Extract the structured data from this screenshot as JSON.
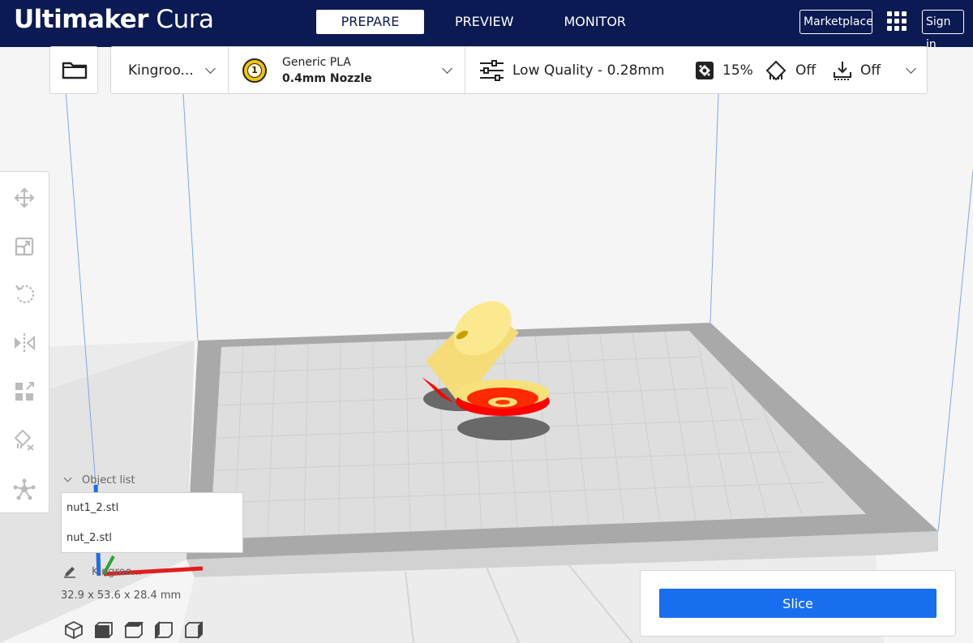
{
  "app": {
    "brand_bold": "Ultimaker",
    "brand_light": "Cura"
  },
  "stages": [
    {
      "label": "PREPARE",
      "active": true
    },
    {
      "label": "PREVIEW",
      "active": false
    },
    {
      "label": "MONITOR",
      "active": false
    }
  ],
  "header_buttons": {
    "marketplace": "Marketplace",
    "sign_in": "Sign in"
  },
  "toolbar": {
    "printer": "Kingroo...",
    "extruder_number": "1",
    "material": "Generic PLA",
    "nozzle": "0.4mm Nozzle",
    "quality": "Low Quality - 0.28mm",
    "infill": "15%",
    "support": "Off",
    "adhesion": "Off"
  },
  "tools": [
    "move-tool-icon",
    "scale-tool-icon",
    "rotate-tool-icon",
    "mirror-tool-icon",
    "per-model-settings-icon",
    "support-blocker-icon",
    "custom-supports-icon"
  ],
  "object_list": {
    "header": "Object list",
    "items": [
      "nut1_2.stl",
      "nut_2.stl"
    ]
  },
  "job": {
    "name": "Kingroo...",
    "dimensions": "32.9 x 53.6 x 28.4 mm"
  },
  "slice": {
    "button_label": "Slice"
  },
  "colors": {
    "header_bg": "#0b1a52",
    "slice_blue": "#196ef0",
    "model_yellow": "#f7e27a",
    "overhang_red": "#ff0000"
  }
}
